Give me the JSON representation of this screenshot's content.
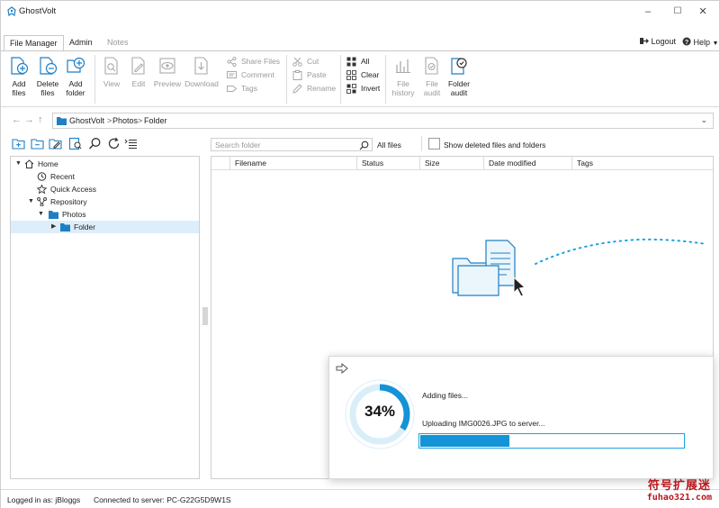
{
  "window": {
    "title": "GhostVolt",
    "controls": {
      "minimize": "–",
      "maximize": "☐",
      "close": "✕"
    }
  },
  "tabs": [
    {
      "label": "File Manager",
      "active": true
    },
    {
      "label": "Admin",
      "active": false
    },
    {
      "label": "Notes",
      "active": false,
      "disabled": true
    }
  ],
  "menu": {
    "logout": "Logout",
    "help": "Help"
  },
  "ribbon": {
    "add_files": "Add\nfiles",
    "delete_files": "Delete\nfiles",
    "add_folder": "Add\nfolder",
    "view": "View",
    "edit": "Edit",
    "preview": "Preview",
    "download": "Download",
    "share_files": "Share Files",
    "comment": "Comment",
    "tags": "Tags",
    "cut": "Cut",
    "paste": "Paste",
    "rename": "Rename",
    "all": "All",
    "clear": "Clear",
    "invert": "Invert",
    "file_history": "File\nhistory",
    "file_audit": "File\naudit",
    "folder_audit": "Folder\naudit"
  },
  "breadcrumb": [
    "GhostVolt",
    "Photos",
    "Folder"
  ],
  "breadcrumb_sep": ">",
  "search": {
    "placeholder": "Search folder",
    "scope": "All files"
  },
  "show_deleted_label": "Show deleted files and folders",
  "tree": [
    {
      "label": "Home",
      "icon": "home-icon",
      "expanded": true
    },
    {
      "label": "Recent",
      "icon": "clock-icon"
    },
    {
      "label": "Quick Access",
      "icon": "star-icon"
    },
    {
      "label": "Repository",
      "icon": "repository-icon",
      "expanded": true
    },
    {
      "label": "Photos",
      "icon": "folder-icon",
      "expanded": true
    },
    {
      "label": "Folder",
      "icon": "folder-icon",
      "selected": true
    }
  ],
  "columns": [
    "Filename",
    "Status",
    "Size",
    "Date modified",
    "Tags"
  ],
  "upload": {
    "percent_label": "34%",
    "progress": 0.34,
    "line1": "Adding files...",
    "line2": "Uploading IMG0026.JPG to server..."
  },
  "status": {
    "logged_in": "Logged in as: jBloggs",
    "connected": "Connected to server: PC-G22G5D9W1S"
  },
  "watermark": {
    "line1": "符号扩展迷",
    "line2": "fuhao321.com"
  },
  "colors": {
    "accent": "#1493d6",
    "icon_blue": "#1f7fc4",
    "watermark": "#b8161c"
  }
}
